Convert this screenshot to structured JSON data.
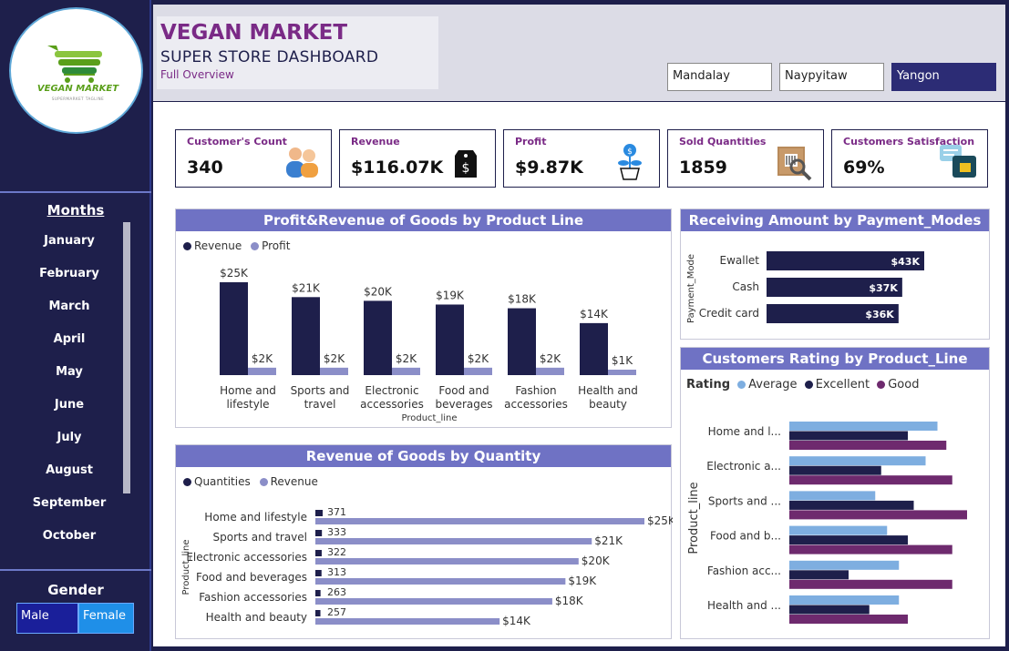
{
  "brand": {
    "logo_text": "VEGAN MARKET",
    "logo_tagline": "SUPERMARKET TAGLINE"
  },
  "sidebar": {
    "months_title": "Months",
    "months": [
      "January",
      "February",
      "March",
      "April",
      "May",
      "June",
      "July",
      "August",
      "September",
      "October"
    ],
    "gender_title": "Gender",
    "gender_options": [
      "Male",
      "Female"
    ]
  },
  "header": {
    "title": "VEGAN MARKET",
    "subtitle": "SUPER STORE DASHBOARD",
    "caption": "Full Overview",
    "cities": [
      "Mandalay",
      "Naypyitaw",
      "Yangon"
    ],
    "selected_city": "Yangon"
  },
  "kpis": [
    {
      "label": "Customer's Count",
      "value": "340",
      "icon": "customers-icon"
    },
    {
      "label": "Revenue",
      "value": "$116.07K",
      "icon": "price-tag-icon"
    },
    {
      "label": "Profit",
      "value": "$9.87K",
      "icon": "money-plant-icon"
    },
    {
      "label": "Sold Quantities",
      "value": "1859",
      "icon": "barcode-box-icon"
    },
    {
      "label": "Customers Satisfaction",
      "value": "69%",
      "icon": "feedback-icon"
    }
  ],
  "colors": {
    "dark": "#1e1f4b",
    "light": "#8b8ec8",
    "avg": "#7eaee0",
    "exc": "#1e1f4b",
    "good": "#6e2a6e",
    "header": "#6f72c4"
  },
  "chart_data": [
    {
      "type": "bar",
      "title": "Profit&Revenue of Goods by Product Line",
      "xlabel": "Product_line",
      "categories": [
        "Home and lifestyle",
        "Sports and travel",
        "Electronic accessories",
        "Food and beverages",
        "Fashion accessories",
        "Health and beauty"
      ],
      "category_lines": [
        [
          "Home and",
          "lifestyle"
        ],
        [
          "Sports and",
          "travel"
        ],
        [
          "Electronic",
          "accessories"
        ],
        [
          "Food and",
          "beverages"
        ],
        [
          "Fashion",
          "accessories"
        ],
        [
          "Health and",
          "beauty"
        ]
      ],
      "series": [
        {
          "name": "Revenue",
          "values": [
            25,
            21,
            20,
            19,
            18,
            14
          ],
          "labels": [
            "$25K",
            "$21K",
            "$20K",
            "$19K",
            "$18K",
            "$14K"
          ]
        },
        {
          "name": "Profit",
          "values": [
            2,
            2,
            2,
            2,
            2,
            1
          ],
          "labels": [
            "$2K",
            "$2K",
            "$2K",
            "$2K",
            "$2K",
            "$1K"
          ]
        }
      ]
    },
    {
      "type": "bar",
      "orientation": "horizontal",
      "title": "Receiving Amount by Payment_Modes",
      "ylabel": "Payment_Mode",
      "categories": [
        "Ewallet",
        "Cash",
        "Credit card"
      ],
      "values": [
        43,
        37,
        36
      ],
      "labels": [
        "$43K",
        "$37K",
        "$36K"
      ]
    },
    {
      "type": "bar",
      "orientation": "horizontal",
      "title": "Revenue of Goods by Quantity",
      "ylabel": "Product_line",
      "categories": [
        "Home and lifestyle",
        "Sports and travel",
        "Electronic accessories",
        "Food and beverages",
        "Fashion accessories",
        "Health and beauty"
      ],
      "series": [
        {
          "name": "Quantities",
          "values": [
            371,
            333,
            322,
            313,
            263,
            257
          ],
          "labels": [
            "371",
            "333",
            "322",
            "313",
            "263",
            "257"
          ]
        },
        {
          "name": "Revenue",
          "values": [
            25,
            21,
            20,
            19,
            18,
            14
          ],
          "labels": [
            "$25K",
            "$21K",
            "$20K",
            "$19K",
            "$18K",
            "$14K"
          ]
        }
      ]
    },
    {
      "type": "bar",
      "orientation": "horizontal",
      "title": "Customers Rating by Product_Line",
      "ylabel": "Product_line",
      "legend_title": "Rating",
      "categories": [
        "Home and l...",
        "Electronic a...",
        "Sports and ...",
        "Food and b...",
        "Fashion acc...",
        "Health and ..."
      ],
      "series": [
        {
          "name": "Average",
          "values": [
            50,
            46,
            29,
            33,
            37,
            37
          ]
        },
        {
          "name": "Excellent",
          "values": [
            40,
            31,
            42,
            40,
            20,
            27
          ]
        },
        {
          "name": "Good",
          "values": [
            53,
            55,
            60,
            55,
            55,
            40
          ]
        }
      ]
    }
  ]
}
